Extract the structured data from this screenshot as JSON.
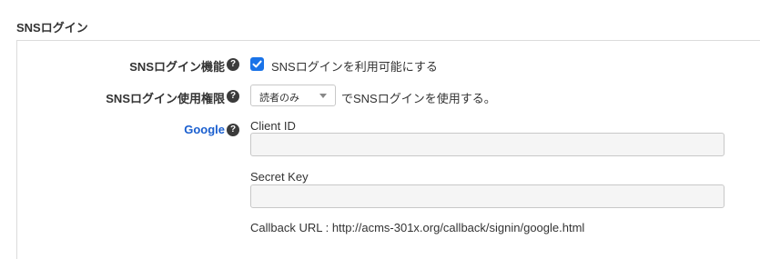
{
  "section": {
    "title": "SNSログイン"
  },
  "rows": {
    "feature": {
      "label": "SNSログイン機能",
      "checkbox_label": "SNSログインを利用可能にする",
      "checked": true
    },
    "permission": {
      "label": "SNSログイン使用権限",
      "select_value": "読者のみ",
      "suffix": "でSNSログインを使用する。"
    },
    "google": {
      "label": "Google",
      "client_id_label": "Client ID",
      "client_id_value": "",
      "secret_key_label": "Secret Key",
      "secret_key_value": "",
      "callback_text": "Callback URL : http://acms-301x.org/callback/signin/google.html"
    }
  },
  "icons": {
    "help": "question-circle-icon",
    "checkbox": "checkmark-icon",
    "select_arrow": "caret-down-icon"
  },
  "colors": {
    "accent": "#1a73e8",
    "link": "#1a5fcf",
    "help_icon": "#3b3b3b"
  }
}
